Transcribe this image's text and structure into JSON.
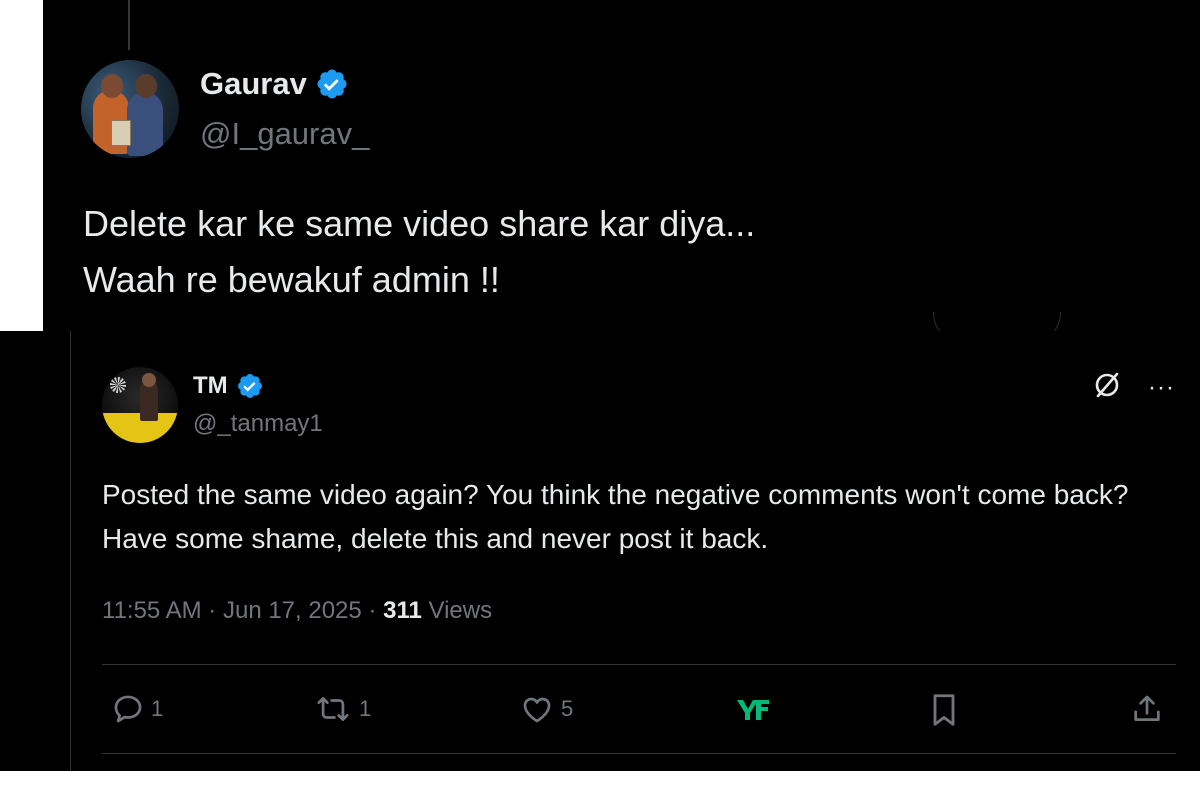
{
  "parent_tweet": {
    "author_name": "Gaurav",
    "author_handle": "@I_gaurav_",
    "verified": true,
    "text_line1": "Delete kar ke same video share kar diya...",
    "text_line2": "Waah re bewakuf admin !!"
  },
  "main_tweet": {
    "author_name": "TM",
    "author_handle": "@_tanmay1",
    "verified": true,
    "text": "Posted the same video again? You think the negative comments won't come back? Have some shame, delete this and never post it back.",
    "time": "11:55 AM",
    "separator": "·",
    "date": "Jun 17, 2025",
    "views_count": "311",
    "views_label": "Views",
    "more_icon": "···"
  },
  "actions": {
    "reply_count": "1",
    "retweet_count": "1",
    "like_count": "5"
  },
  "colors": {
    "background": "#000000",
    "text_primary": "#e7e9ea",
    "text_secondary": "#71767b",
    "verified_blue": "#1d9bf0",
    "grok_green": "#00ba7c",
    "divider": "#2f3336"
  }
}
